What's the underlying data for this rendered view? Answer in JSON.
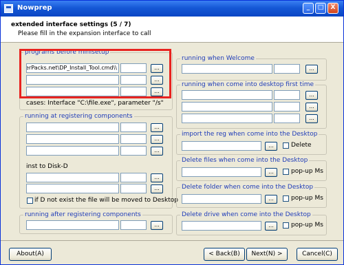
{
  "window": {
    "title": "Nowprep",
    "minimize": "_",
    "maximize": "□",
    "close": "X"
  },
  "header": {
    "title": "extended interface settings (5 / 7)",
    "subtitle": "Please fill in the expansion interface to call"
  },
  "browse_label": "...",
  "left": {
    "before_minisetup": {
      "title": "programs before minisetup",
      "rows": [
        {
          "path": "\\\\erPacks.net\\DP_Install_Tool.cmd",
          "param": ""
        },
        {
          "path": "",
          "param": ""
        },
        {
          "path": "",
          "param": ""
        }
      ],
      "cases": "cases: Interface \"C:\\file.exe\", parameter \"/s\""
    },
    "registering": {
      "title": "running at registering components",
      "inst_label": "inst to Disk-D",
      "move_note": "if D not exist the file will be moved to Desktop"
    },
    "after_registering": {
      "title": "running after registering components"
    }
  },
  "right": {
    "welcome": {
      "title": "running when Welcome"
    },
    "first_desktop": {
      "title": "running when come into desktop first time"
    },
    "import_reg": {
      "title": "import the reg when come into the Desktop",
      "delete_label": "Delete"
    },
    "delete_files": {
      "title": "Delete files when come into the Desktop",
      "popup_label": "pop-up Ms"
    },
    "delete_folder": {
      "title": "Delete folder when come into the Desktop",
      "popup_label": "pop-up Ms"
    },
    "delete_drive": {
      "title": "Delete drive when come into the Desktop",
      "popup_label": "pop-up Ms"
    }
  },
  "footer": {
    "about": "About(A)",
    "back": "< Back(B)",
    "next": "Next(N) >",
    "cancel": "Cancel(C)"
  }
}
